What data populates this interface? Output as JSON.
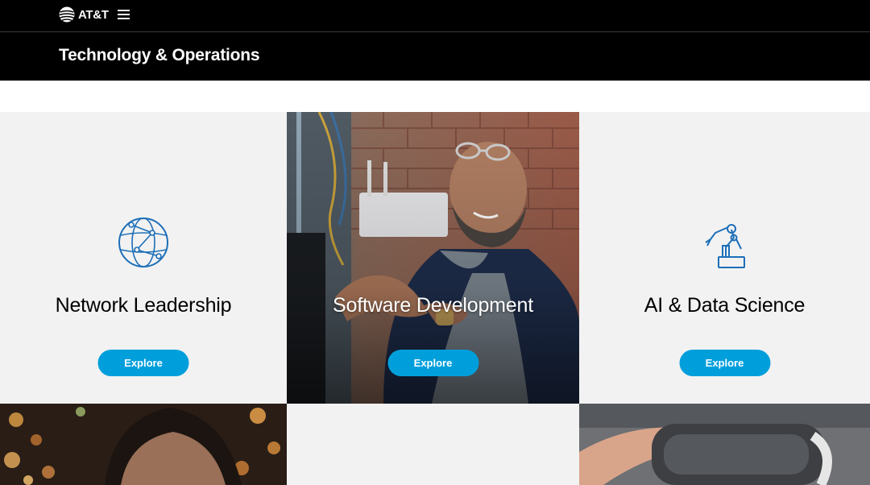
{
  "header": {
    "brand": "AT&T",
    "menu_icon": "hamburger-menu-icon",
    "page_title": "Technology & Operations"
  },
  "colors": {
    "header_bg": "#000000",
    "tile_bg": "#f2f2f2",
    "accent": "#009fdb",
    "icon_stroke": "#1d6fb8"
  },
  "tiles": [
    {
      "title": "Network Leadership",
      "button": "Explore",
      "icon": "globe-network-icon"
    },
    {
      "title": "Software Development",
      "button": "Explore",
      "image": "developer-photo"
    },
    {
      "title": "AI & Data Science",
      "button": "Explore",
      "icon": "robotic-arm-icon"
    }
  ],
  "bottom_tiles": [
    {
      "image": "person-bokeh-photo"
    },
    {
      "image": "blank"
    },
    {
      "image": "vr-headset-photo"
    }
  ]
}
